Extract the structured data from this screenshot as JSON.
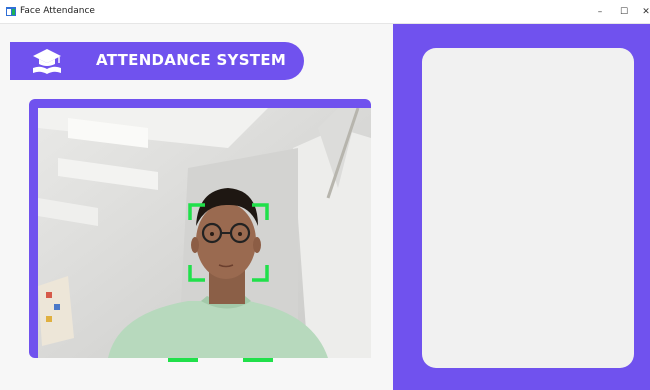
{
  "window": {
    "title": "Face Attendance",
    "controls": {
      "minimize": "–",
      "maximize": "☐",
      "close": "✕"
    }
  },
  "header": {
    "title": "ATTENDANCE SYSTEM",
    "icon": "graduation-cap-book-icon"
  },
  "camera": {
    "detection_box_color": "#20e04a"
  },
  "colors": {
    "accent": "#7052ee",
    "panel": "#f1f1f1",
    "detection": "#20e04a"
  }
}
